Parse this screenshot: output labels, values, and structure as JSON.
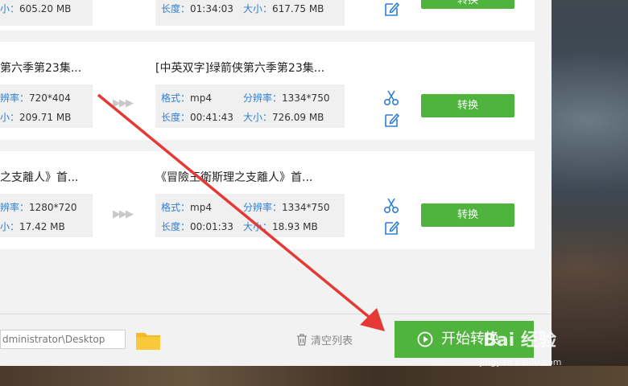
{
  "rows": [
    {
      "src_title": "",
      "src_res_label": "",
      "src_res": "",
      "src_size_label": "小：",
      "src_size": "605.20 MB",
      "dst_title": "",
      "dst_fmt_label": "",
      "dst_fmt": "",
      "dst_res_label": "",
      "dst_res": "",
      "dst_dur_label": "长度：",
      "dst_dur": "01:34:03",
      "dst_size_label": "大小：",
      "dst_size": "617.75 MB",
      "convert_label": "转换"
    },
    {
      "src_title": "第六季第23集...",
      "src_res_label": "辨率：",
      "src_res": "720*404",
      "src_size_label": "小：",
      "src_size": "209.71 MB",
      "dst_title": "[中英双字]绿箭侠第六季第23集...",
      "dst_fmt_label": "格式：",
      "dst_fmt": "mp4",
      "dst_res_label": "分辨率：",
      "dst_res": "1334*750",
      "dst_dur_label": "长度：",
      "dst_dur": "00:41:43",
      "dst_size_label": "大小：",
      "dst_size": "726.09 MB",
      "convert_label": "转换"
    },
    {
      "src_title": "之支離人》首...",
      "src_res_label": "辨率：",
      "src_res": "1280*720",
      "src_size_label": "小：",
      "src_size": "17.42 MB",
      "dst_title": "《冒險王衛斯理之支離人》首...",
      "dst_fmt_label": "格式：",
      "dst_fmt": "mp4",
      "dst_res_label": "分辨率：",
      "dst_res": "1334*750",
      "dst_dur_label": "长度：",
      "dst_dur": "00:01:33",
      "dst_size_label": "大小：",
      "dst_size": "18.93 MB",
      "convert_label": "转换"
    }
  ],
  "footer": {
    "output_path": "dministrator\\Desktop",
    "clear_label": "清空列表",
    "start_label": "开始转换"
  },
  "watermark": {
    "brand": "Bai 经验",
    "url": "jingyan.baidu.com"
  },
  "colors": {
    "accent_green": "#4fb33e",
    "label_blue": "#2e7fd6",
    "arrow_red": "#e53935"
  },
  "icons": [
    "scissors-icon",
    "edit-icon",
    "folder-icon",
    "trash-icon",
    "play-circle-icon"
  ]
}
